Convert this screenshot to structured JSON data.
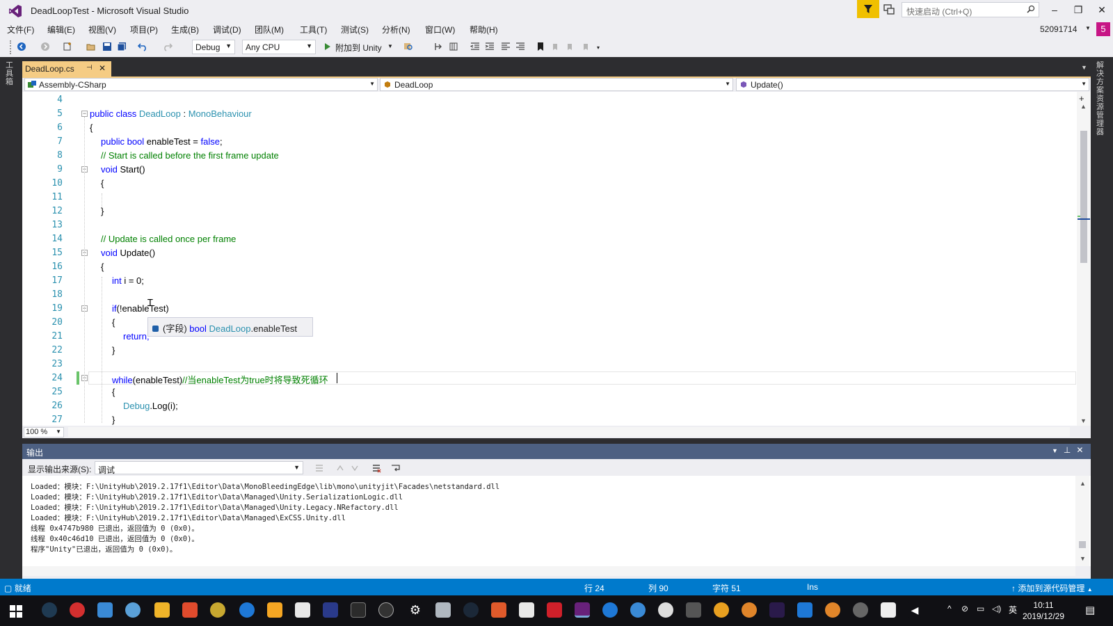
{
  "window": {
    "title": "DeadLoopTest - Microsoft Visual Studio",
    "quick_launch_placeholder": "快速启动 (Ctrl+Q)",
    "account": "52091714",
    "avatar_letter": "5"
  },
  "menu": [
    "文件(F)",
    "编辑(E)",
    "视图(V)",
    "项目(P)",
    "生成(B)",
    "调试(D)",
    "团队(M)",
    "工具(T)",
    "测试(S)",
    "分析(N)",
    "窗口(W)",
    "帮助(H)"
  ],
  "toolbar": {
    "config": "Debug",
    "platform": "Any CPU",
    "attach_label": "附加到 Unity"
  },
  "side_tabs": {
    "left": "工具箱",
    "right": "解决方案资源管理器"
  },
  "document_tab": {
    "name": "DeadLoop.cs"
  },
  "navbar": {
    "project": "Assembly-CSharp",
    "class": "DeadLoop",
    "member": "Update()"
  },
  "editor": {
    "line_numbers": [
      "4",
      "5",
      "6",
      "7",
      "8",
      "9",
      "10",
      "11",
      "12",
      "13",
      "14",
      "15",
      "16",
      "17",
      "18",
      "19",
      "20",
      "21",
      "22",
      "23",
      "24",
      "25",
      "26",
      "27"
    ],
    "tooltip": {
      "kind": "(字段)",
      "type": "bool",
      "owner": "DeadLoop",
      "member": ".enableTest"
    },
    "zoom": "100 %"
  },
  "code": {
    "l5_public": "public",
    "l5_class": "class",
    "l5_name": "DeadLoop",
    "l5_colon": " : ",
    "l5_base": "MonoBehaviour",
    "l6": "{",
    "l7_public": "public",
    "l7_bool": "bool",
    "l7_name": " enableTest = ",
    "l7_false": "false",
    "l7_end": ";",
    "l8": "// Start is called before the first frame update",
    "l9_void": "void",
    "l9_name": " Start()",
    "l10": "{",
    "l12": "}",
    "l14": "// Update is called once per frame",
    "l15_void": "void",
    "l15_name": " Update()",
    "l16": "{",
    "l17_int": "int",
    "l17_rest": " i = 0;",
    "l19_if": "if",
    "l19_rest": "(!enableTest)",
    "l20": "{",
    "l21": "return;",
    "l22": "}",
    "l24_while": "while",
    "l24_rest": "(enableTest)",
    "l24_comment": "//当enableTest为true时将导致死循环",
    "l25": "{",
    "l26_type": "Debug",
    "l26_rest": ".Log(i);",
    "l27": "}"
  },
  "output": {
    "title": "输出",
    "source_label": "显示输出来源(S):",
    "source_value": "调试",
    "lines": [
      "Loaded：模块：F:\\UnityHub\\2019.2.17f1\\Editor\\Data\\MonoBleedingEdge\\lib\\mono\\unityjit\\Facades\\netstandard.dll",
      "Loaded：模块：F:\\UnityHub\\2019.2.17f1\\Editor\\Data\\Managed\\Unity.SerializationLogic.dll",
      "Loaded：模块：F:\\UnityHub\\2019.2.17f1\\Editor\\Data\\Managed\\Unity.Legacy.NRefactory.dll",
      "Loaded：模块：F:\\UnityHub\\2019.2.17f1\\Editor\\Data\\Managed\\ExCSS.Unity.dll",
      "线程 0x4747b980 已退出，返回值为 0 (0x0)。",
      "线程 0x40c46d10 已退出，返回值为 0 (0x0)。",
      "程序\"Unity\"已退出，返回值为 0 (0x0)。"
    ]
  },
  "status": {
    "state": "就绪",
    "line": "行 24",
    "col": "列 90",
    "char": "字符 51",
    "mode": "Ins",
    "source_control": "添加到源代码管理"
  },
  "taskbar": {
    "time": "10:11",
    "date": "2019/12/29",
    "ime": "英"
  },
  "colors": {
    "accent": "#007acc",
    "tab_active": "#f5cc84",
    "keyword": "#0000ff",
    "type": "#2b91af",
    "comment": "#008000",
    "output_header": "#4d6082"
  }
}
